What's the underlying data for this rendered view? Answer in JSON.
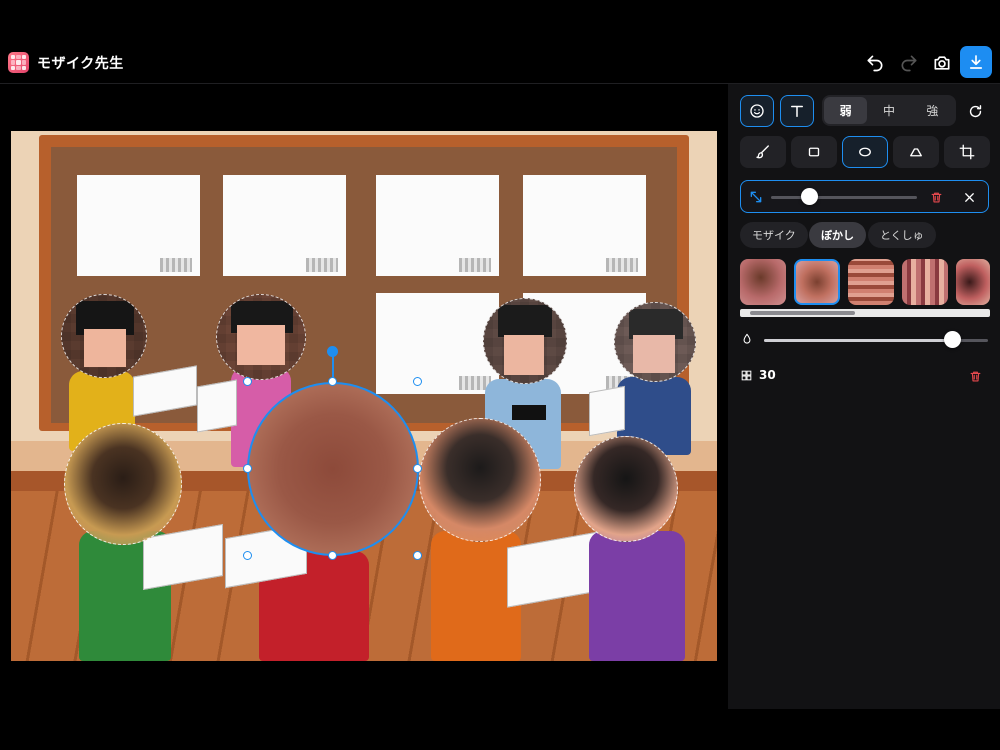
{
  "app": {
    "title": "モザイク先生"
  },
  "toolbar": {
    "undo_icon": "undo-icon",
    "redo_icon": "redo-icon",
    "camera_icon": "camera-icon",
    "download_icon": "download-icon"
  },
  "panel": {
    "strength": {
      "options": [
        "弱",
        "中",
        "強"
      ],
      "selected": "弱"
    },
    "tools": [
      "brush",
      "rectangle",
      "ellipse",
      "eraser",
      "crop"
    ],
    "selected_tool": "ellipse",
    "size_slider": {
      "value": 0.26
    },
    "modes": [
      "モザイク",
      "ぼかし",
      "とくしゅ"
    ],
    "selected_mode": "ぼかし",
    "thumbnails_selected_index": 1,
    "opacity_slider": {
      "value": 0.84
    },
    "count": "30",
    "colors": {
      "accent": "#1e8ef0",
      "delete": "#e5484d"
    }
  }
}
